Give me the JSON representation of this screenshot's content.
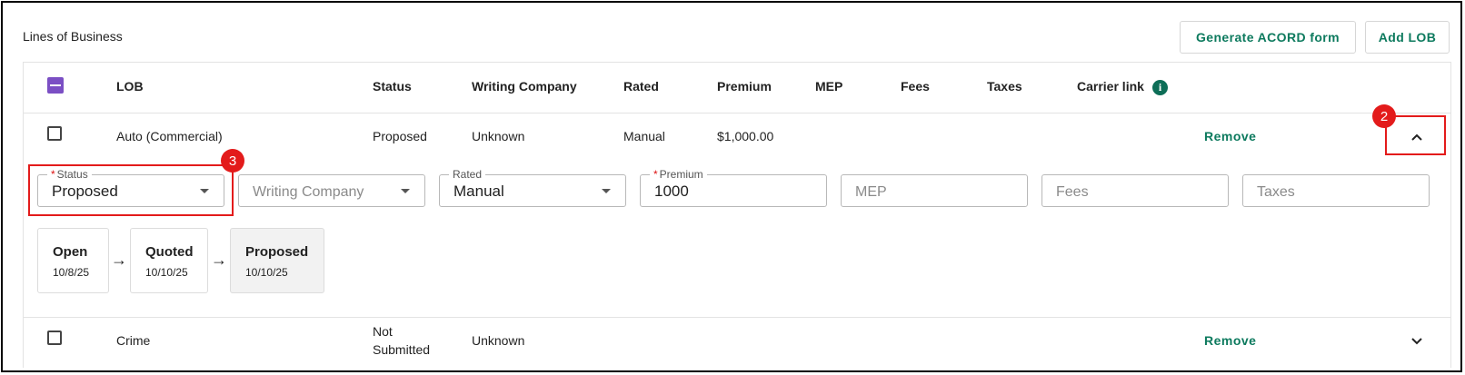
{
  "section_title": "Lines of Business",
  "toolbar": {
    "generate_label": "Generate ACORD form",
    "add_label": "Add LOB"
  },
  "columns": {
    "lob": "LOB",
    "status": "Status",
    "writing_company": "Writing Company",
    "rated": "Rated",
    "premium": "Premium",
    "mep": "MEP",
    "fees": "Fees",
    "taxes": "Taxes",
    "carrier_link": "Carrier link"
  },
  "icons": {
    "info": "info-icon",
    "expand": "chevron-up-icon",
    "collapse": "chevron-down-icon",
    "arrow": "arrow-right-icon"
  },
  "rows": [
    {
      "lob": "Auto (Commercial)",
      "status": "Proposed",
      "writing_company": "Unknown",
      "rated": "Manual",
      "premium": "$1,000.00",
      "remove_label": "Remove",
      "expanded": true
    },
    {
      "lob": "Crime",
      "status_line1": "Not",
      "status_line2": "Submitted",
      "writing_company": "Unknown",
      "remove_label": "Remove",
      "expanded": false
    }
  ],
  "detail": {
    "status": {
      "label": "Status",
      "value": "Proposed",
      "required": true
    },
    "writing_company": {
      "placeholder": "Writing Company"
    },
    "rated": {
      "label": "Rated",
      "value": "Manual"
    },
    "premium": {
      "label": "Premium",
      "value": "1000",
      "required": true
    },
    "mep": {
      "placeholder": "MEP"
    },
    "fees": {
      "placeholder": "Fees"
    },
    "taxes": {
      "placeholder": "Taxes"
    },
    "timeline": [
      {
        "name": "Open",
        "date": "10/8/25"
      },
      {
        "name": "Quoted",
        "date": "10/10/25"
      },
      {
        "name": "Proposed",
        "date": "10/10/25"
      }
    ]
  },
  "annotations": {
    "badge_expand": "2",
    "badge_status": "3"
  },
  "colors": {
    "accent": "#0d7a5e",
    "checkbox_master": "#7b4fc4",
    "annotation": "#e31b1b",
    "required": "#dd1111"
  }
}
